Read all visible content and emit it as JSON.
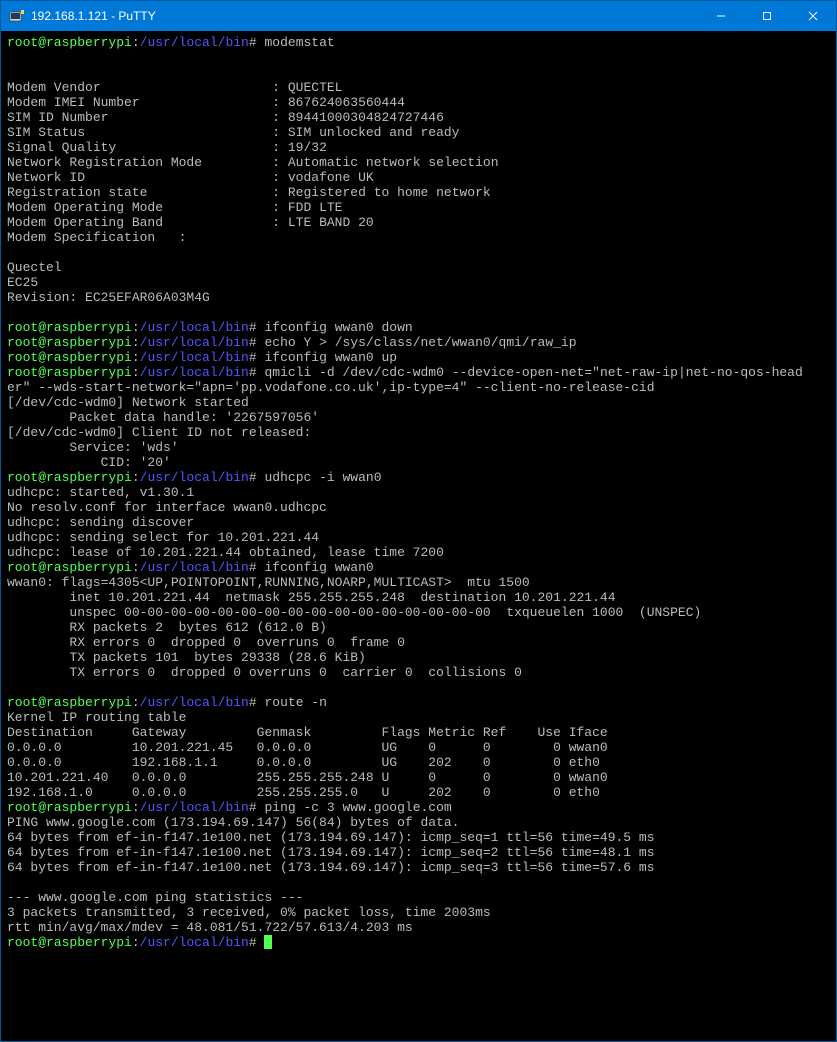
{
  "title": "192.168.1.121 - PuTTY",
  "prompt_user_host": "root@raspberrypi",
  "prompt_path": "/usr/local/bin",
  "prompt_suffix": "#",
  "cmd_modemstat": "modemstat",
  "modem_blank": "",
  "modem": {
    "vendor_k": "Modem Vendor",
    "vendor_v": "QUECTEL",
    "imei_k": "Modem IMEI Number",
    "imei_v": "867624063560444",
    "sim_k": "SIM ID Number",
    "sim_v": "89441000304824727446",
    "simstat_k": "SIM Status",
    "simstat_v": "SIM unlocked and ready",
    "sig_k": "Signal Quality",
    "sig_v": "19/32",
    "netreg_k": "Network Registration Mode",
    "netreg_v": "Automatic network selection",
    "netid_k": "Network ID",
    "netid_v": "vodafone UK",
    "regst_k": "Registration state",
    "regst_v": "Registered to home network",
    "opmode_k": "Modem Operating Mode",
    "opmode_v": "FDD LTE",
    "opband_k": "Modem Operating Band",
    "opband_v": "LTE BAND 20",
    "spec_line": "Modem Specification   :",
    "spec_vendor": "Quectel",
    "spec_model": "EC25",
    "spec_rev": "Revision: EC25EFAR06A03M4G"
  },
  "cmd_ifdown": "ifconfig wwan0 down",
  "cmd_echo": "echo Y > /sys/class/net/wwan0/qmi/raw_ip",
  "cmd_ifup": "ifconfig wwan0 up",
  "cmd_qmicli_1": "qmicli -d /dev/cdc-wdm0 --device-open-net=\"net-raw-ip|net-no-qos-head",
  "cmd_qmicli_2": "er\" --wds-start-network=\"apn='pp.vodafone.co.uk',ip-type=4\" --client-no-release-cid",
  "qmi_out": {
    "l1": "[/dev/cdc-wdm0] Network started",
    "l2": "        Packet data handle: '2267597056'",
    "l3": "[/dev/cdc-wdm0] Client ID not released:",
    "l4": "        Service: 'wds'",
    "l5": "            CID: '20'"
  },
  "cmd_udhcpc": "udhcpc -i wwan0",
  "udhcpc_out": {
    "l1": "udhcpc: started, v1.30.1",
    "l2": "No resolv.conf for interface wwan0.udhcpc",
    "l3": "udhcpc: sending discover",
    "l4": "udhcpc: sending select for 10.201.221.44",
    "l5": "udhcpc: lease of 10.201.221.44 obtained, lease time 7200"
  },
  "cmd_ifshow": "ifconfig wwan0",
  "ifcfg_out": {
    "l1": "wwan0: flags=4305<UP,POINTOPOINT,RUNNING,NOARP,MULTICAST>  mtu 1500",
    "l2": "        inet 10.201.221.44  netmask 255.255.255.248  destination 10.201.221.44",
    "l3": "        unspec 00-00-00-00-00-00-00-00-00-00-00-00-00-00-00-00  txqueuelen 1000  (UNSPEC)",
    "l4": "        RX packets 2  bytes 612 (612.0 B)",
    "l5": "        RX errors 0  dropped 0  overruns 0  frame 0",
    "l6": "        TX packets 101  bytes 29338 (28.6 KiB)",
    "l7": "        TX errors 0  dropped 0 overruns 0  carrier 0  collisions 0"
  },
  "cmd_route": "route -n",
  "route_out": {
    "hdr": "Kernel IP routing table",
    "cols": "Destination     Gateway         Genmask         Flags Metric Ref    Use Iface",
    "r1": "0.0.0.0         10.201.221.45   0.0.0.0         UG    0      0        0 wwan0",
    "r2": "0.0.0.0         192.168.1.1     0.0.0.0         UG    202    0        0 eth0",
    "r3": "10.201.221.40   0.0.0.0         255.255.255.248 U     0      0        0 wwan0",
    "r4": "192.168.1.0     0.0.0.0         255.255.255.0   U     202    0        0 eth0"
  },
  "cmd_ping": "ping -c 3 www.google.com",
  "ping_out": {
    "l1": "PING www.google.com (173.194.69.147) 56(84) bytes of data.",
    "l2": "64 bytes from ef-in-f147.1e100.net (173.194.69.147): icmp_seq=1 ttl=56 time=49.5 ms",
    "l3": "64 bytes from ef-in-f147.1e100.net (173.194.69.147): icmp_seq=2 ttl=56 time=48.1 ms",
    "l4": "64 bytes from ef-in-f147.1e100.net (173.194.69.147): icmp_seq=3 ttl=56 time=57.6 ms",
    "s1": "--- www.google.com ping statistics ---",
    "s2": "3 packets transmitted, 3 received, 0% packet loss, time 2003ms",
    "s3": "rtt min/avg/max/mdev = 48.081/51.722/57.613/4.203 ms"
  }
}
